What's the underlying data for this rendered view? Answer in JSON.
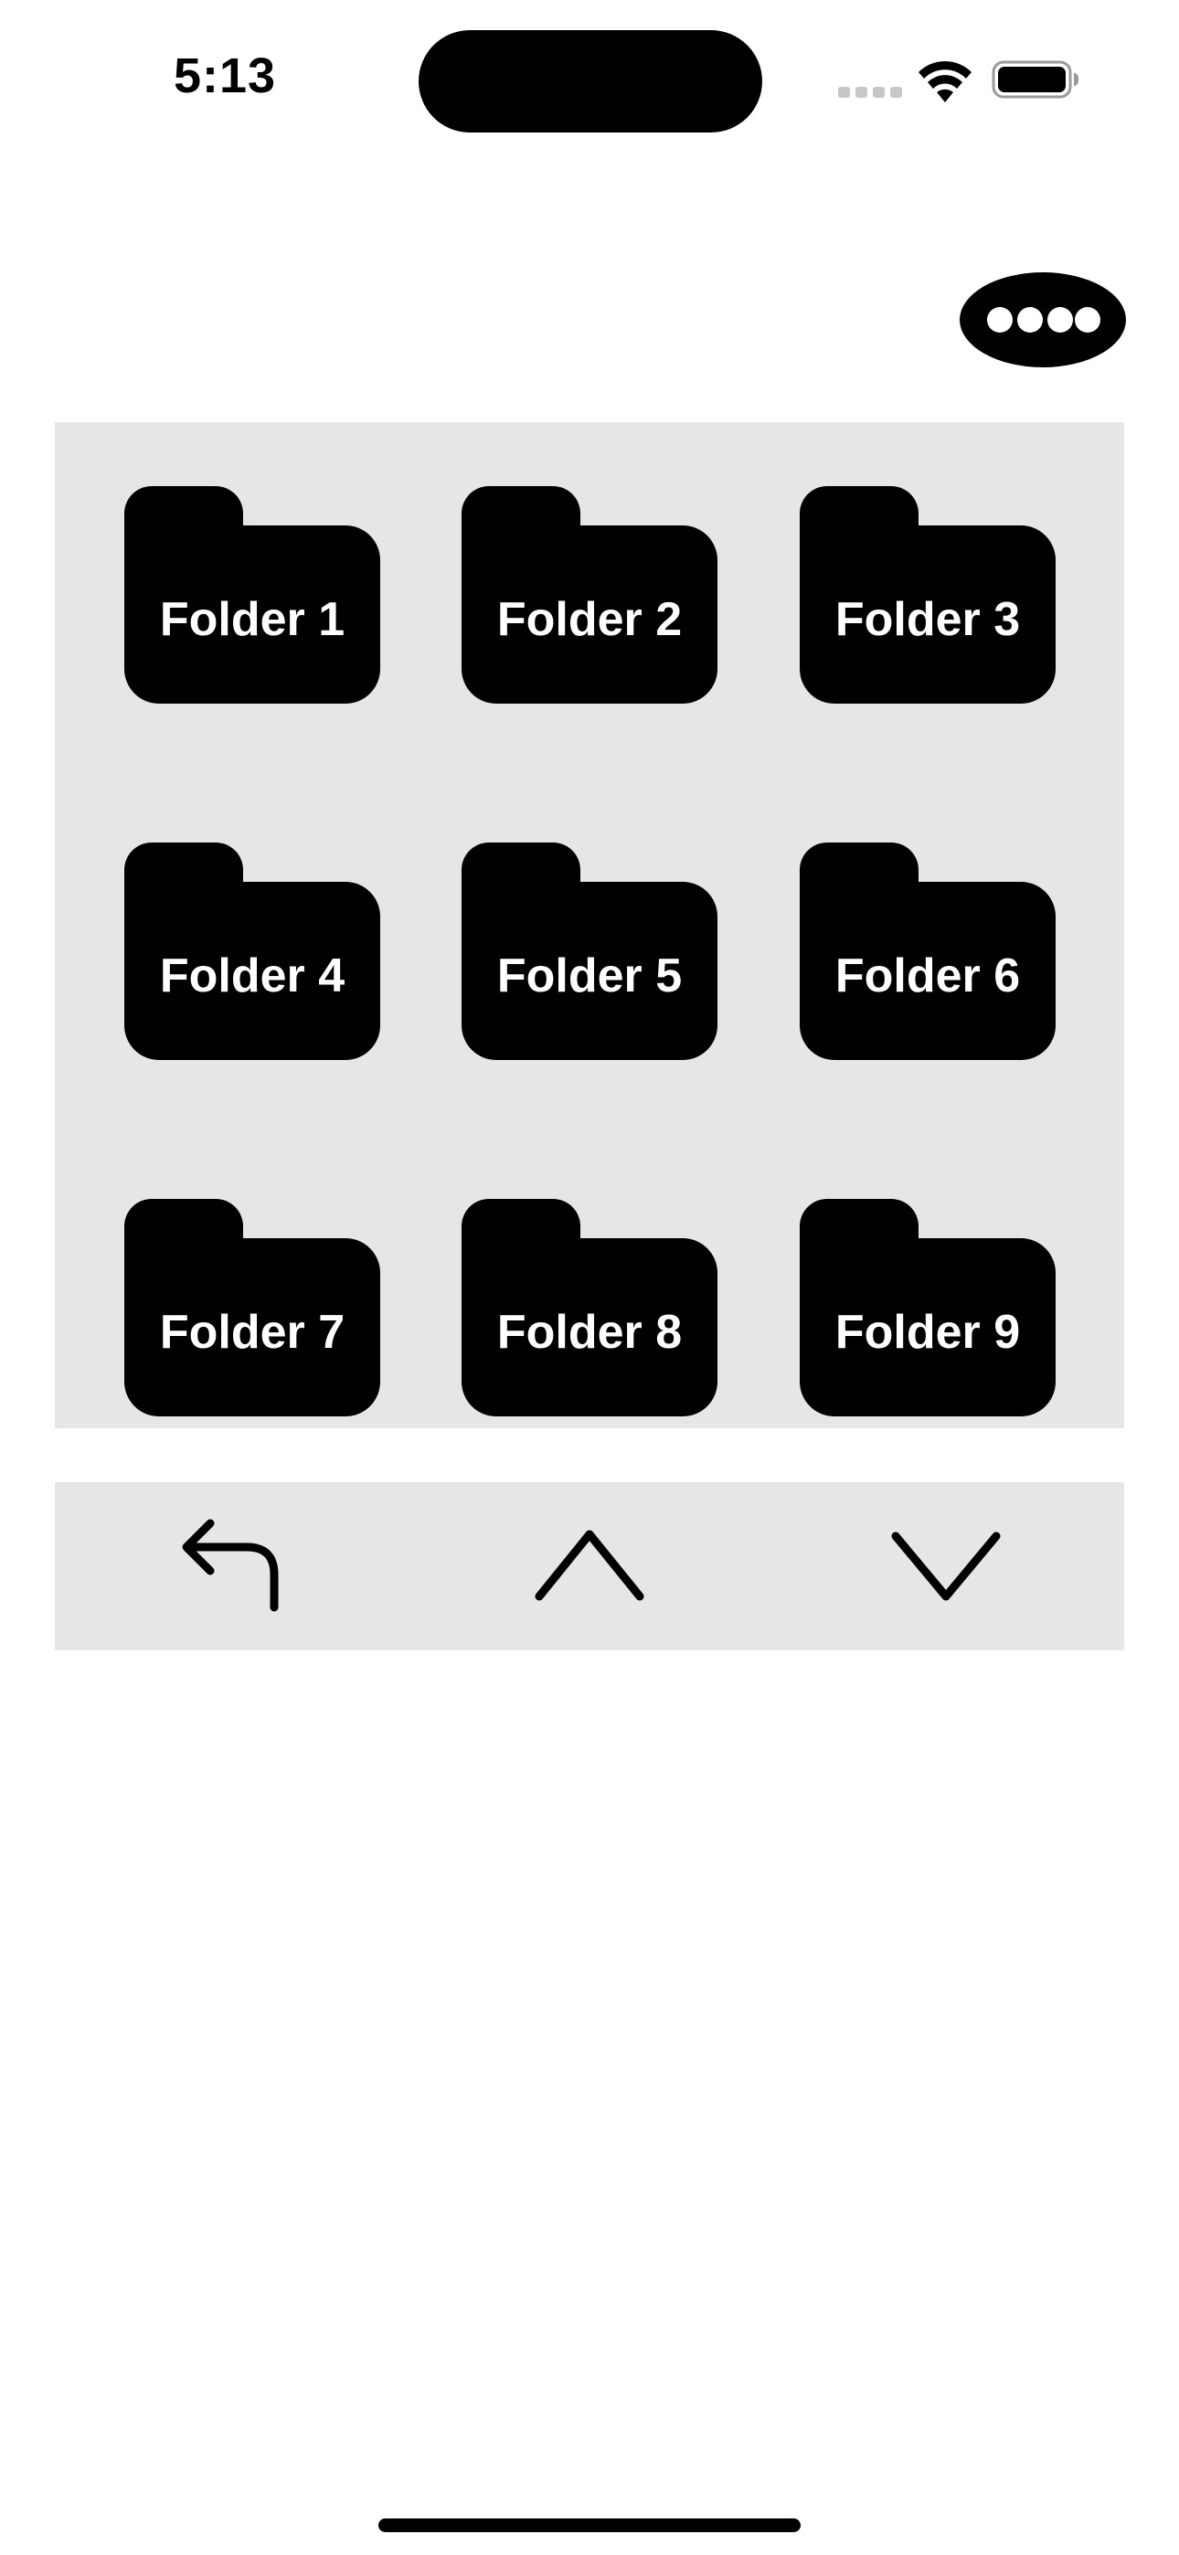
{
  "status_bar": {
    "time": "5:13"
  },
  "toolbar": {
    "more_icon": "more-dots-icon"
  },
  "folders": [
    {
      "label": "Folder 1"
    },
    {
      "label": "Folder 2"
    },
    {
      "label": "Folder 3"
    },
    {
      "label": "Folder 4"
    },
    {
      "label": "Folder 5"
    },
    {
      "label": "Folder 6"
    },
    {
      "label": "Folder 7"
    },
    {
      "label": "Folder 8"
    },
    {
      "label": "Folder 9"
    }
  ],
  "nav_bar": {
    "buttons": [
      {
        "icon": "back-arrow-icon"
      },
      {
        "icon": "chevron-up-icon"
      },
      {
        "icon": "chevron-down-icon"
      }
    ]
  },
  "colors": {
    "background": "#ffffff",
    "panel": "#e6e6e6",
    "foreground": "#000000",
    "folder_label": "#ffffff",
    "signal_inactive": "#c7c7c7"
  }
}
